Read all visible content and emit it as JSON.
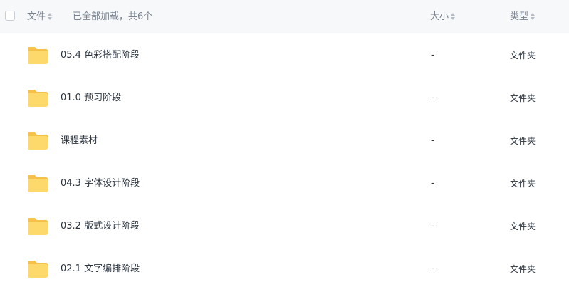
{
  "header": {
    "name_label": "文件",
    "count_label": "已全部加载，共6个",
    "size_label": "大小",
    "type_label": "类型"
  },
  "icons": {
    "folder": "folder-icon",
    "checkbox": "checkbox-icon",
    "sort": "sort-icon"
  },
  "colors": {
    "folder_body": "#fdd86b",
    "folder_tab": "#f6c04a",
    "header_bg": "#f7f8fa"
  },
  "files": [
    {
      "name": "05.4 色彩搭配阶段",
      "size": "-",
      "type": "文件夹"
    },
    {
      "name": "01.0 预习阶段",
      "size": "-",
      "type": "文件夹"
    },
    {
      "name": "课程素材",
      "size": "-",
      "type": "文件夹"
    },
    {
      "name": "04.3 字体设计阶段",
      "size": "-",
      "type": "文件夹"
    },
    {
      "name": "03.2 版式设计阶段",
      "size": "-",
      "type": "文件夹"
    },
    {
      "name": "02.1 文字编排阶段",
      "size": "-",
      "type": "文件夹"
    }
  ]
}
